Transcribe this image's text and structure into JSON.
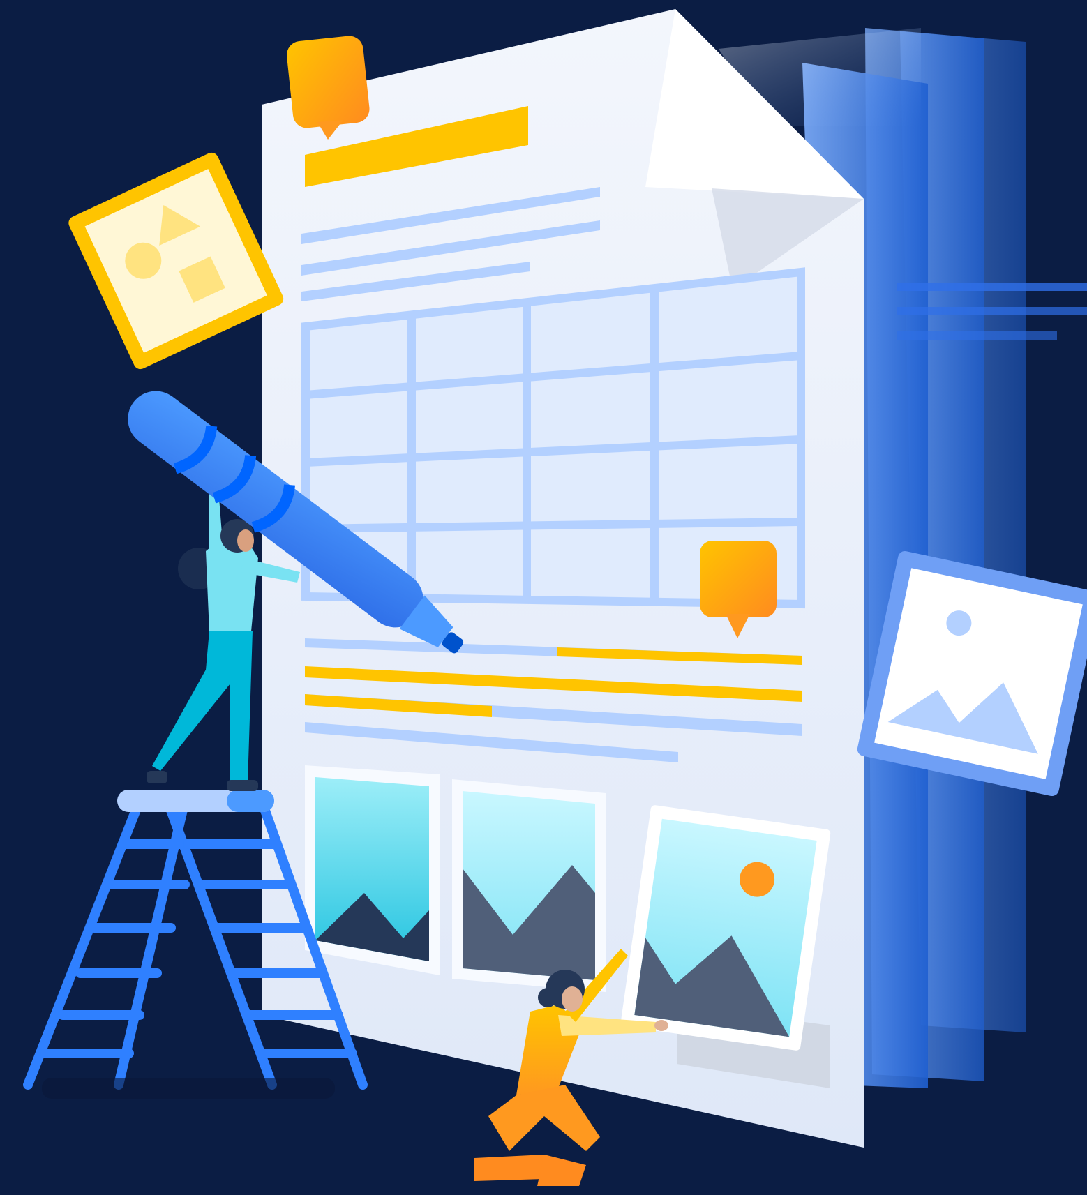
{
  "illustration": {
    "subject": "document-editing-collaboration",
    "colors": {
      "background": "#0b1d44",
      "page": "#edf2fb",
      "page_fold": "#ffffff",
      "accent_blue": "#2f80ff",
      "light_blue": "#b3d0ff",
      "yellow": "#ffc400",
      "orange": "#ff8b1f",
      "cyan": "#79e2f2"
    },
    "icons": [
      "shapes-card-icon",
      "comment-bubble-icon",
      "marker-pen-icon",
      "image-icon",
      "ladder-icon",
      "person-icon"
    ]
  }
}
